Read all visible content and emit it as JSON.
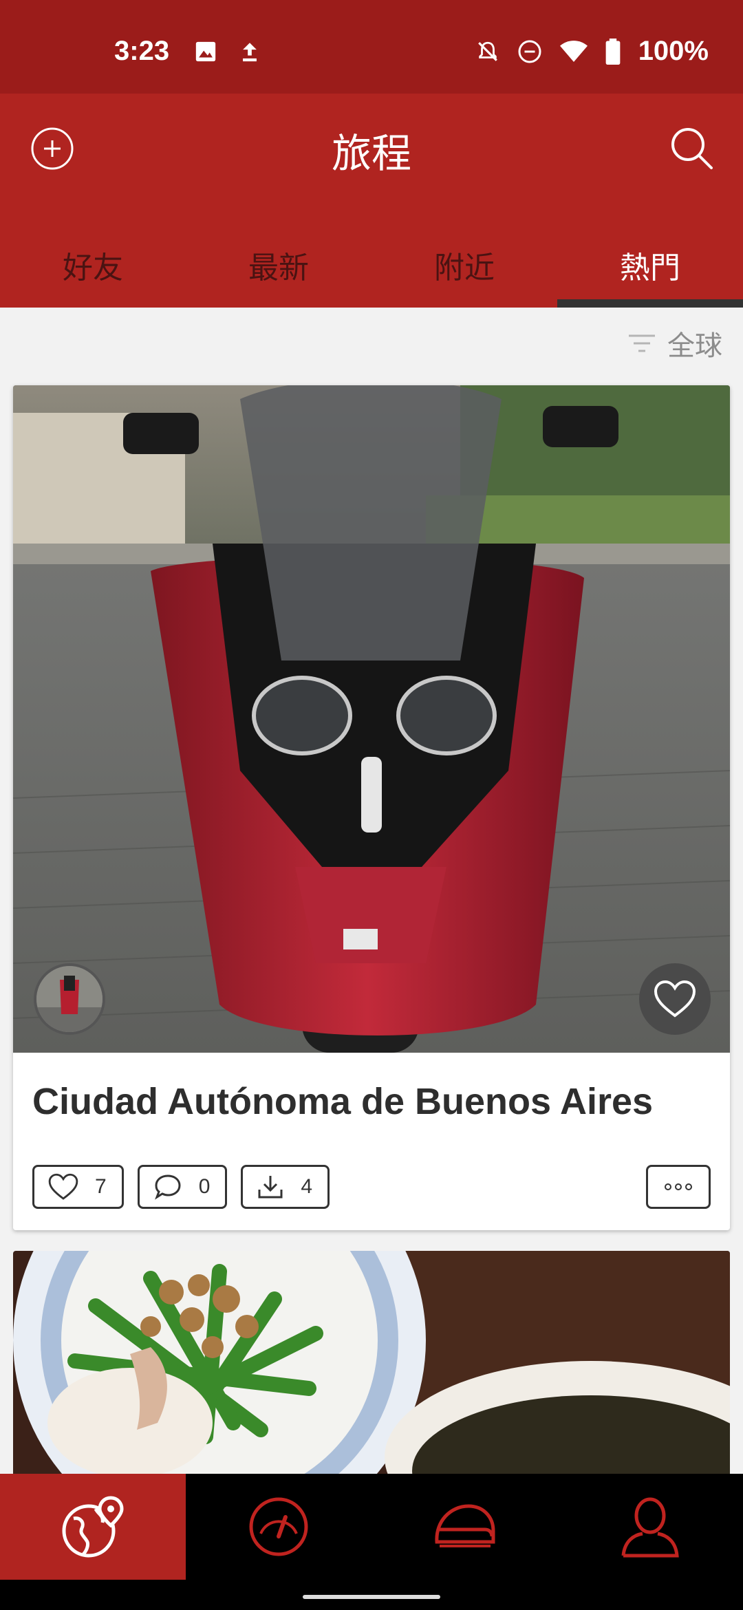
{
  "status": {
    "time": "3:23",
    "battery": "100%",
    "icons": [
      "image-icon",
      "upload-icon",
      "bell-off-icon",
      "dnd-icon",
      "wifi-icon",
      "battery-icon"
    ]
  },
  "appbar": {
    "title": "旅程"
  },
  "tabs": [
    {
      "label": "好友",
      "active": false
    },
    {
      "label": "最新",
      "active": false
    },
    {
      "label": "附近",
      "active": false
    },
    {
      "label": "熱門",
      "active": true
    }
  ],
  "filter": {
    "label": "全球"
  },
  "cards": [
    {
      "title": "Ciudad Autónoma de Buenos Aires",
      "likes": "7",
      "comments": "0",
      "downloads": "4"
    }
  ],
  "bottom_nav": [
    {
      "icon": "globe-pin-icon",
      "active": true
    },
    {
      "icon": "speedometer-icon",
      "active": false
    },
    {
      "icon": "helmet-icon",
      "active": false
    },
    {
      "icon": "profile-icon",
      "active": false
    }
  ],
  "colors": {
    "primary": "#b02420",
    "status_bar": "#9b1c1a",
    "nav_bg": "#000000",
    "nav_icon": "#c0231f"
  }
}
